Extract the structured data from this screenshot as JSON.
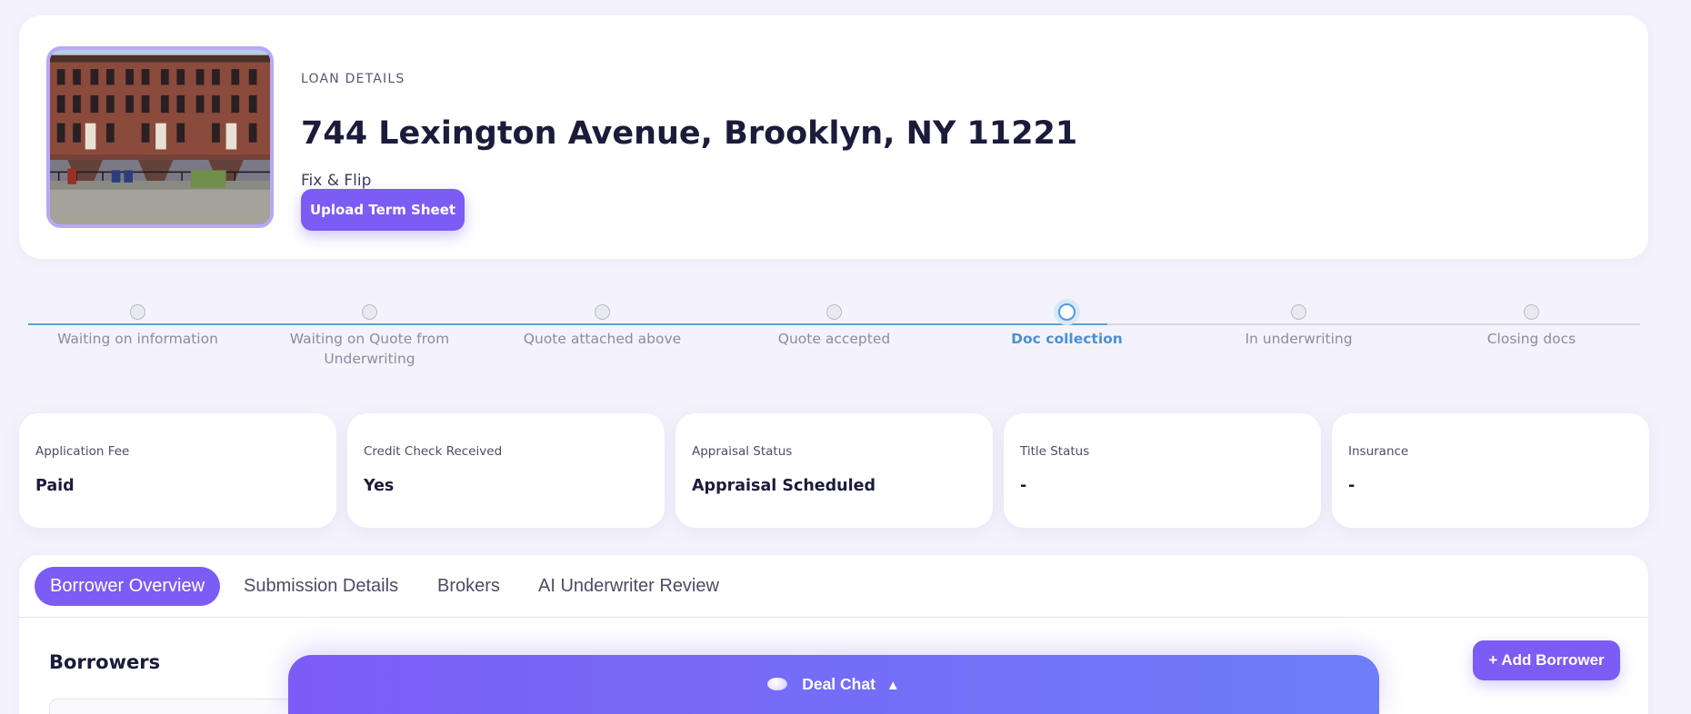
{
  "header": {
    "section_label": "LOAN DETAILS",
    "address": "744 Lexington Avenue, Brooklyn, NY 11221",
    "loan_type": "Fix & Flip",
    "upload_label": "Upload Term Sheet"
  },
  "stepper": {
    "active_index": 4,
    "steps": [
      {
        "label": "Waiting on information"
      },
      {
        "label": "Waiting on Quote from Underwriting"
      },
      {
        "label": "Quote attached above"
      },
      {
        "label": "Quote accepted"
      },
      {
        "label": "Doc collection"
      },
      {
        "label": "In underwriting"
      },
      {
        "label": "Closing docs"
      }
    ]
  },
  "status_cards": [
    {
      "label": "Application Fee",
      "value": "Paid"
    },
    {
      "label": "Credit Check Received",
      "value": "Yes"
    },
    {
      "label": "Appraisal Status",
      "value": "Appraisal Scheduled"
    },
    {
      "label": "Title Status",
      "value": "-"
    },
    {
      "label": "Insurance",
      "value": "-"
    }
  ],
  "tabs": [
    {
      "label": "Borrower Overview",
      "active": true
    },
    {
      "label": "Submission Details",
      "active": false
    },
    {
      "label": "Brokers",
      "active": false
    },
    {
      "label": "AI Underwriter Review",
      "active": false
    }
  ],
  "borrowers": {
    "title": "Borrowers",
    "add_label": "+ Add Borrower"
  },
  "chat": {
    "label": "Deal Chat",
    "icon": "chat-bubble-icon",
    "toggle_icon": "chevron-up-icon"
  },
  "colors": {
    "accent": "#7b5cf5",
    "active_step": "#4d9ae0",
    "background": "#f4f3fb"
  }
}
